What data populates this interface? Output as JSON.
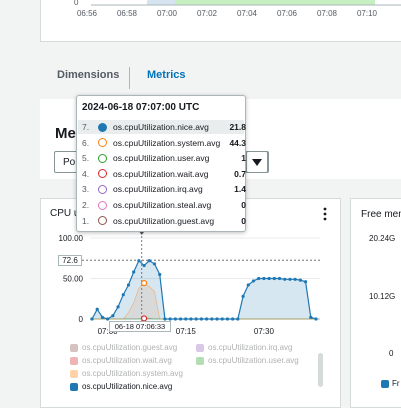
{
  "top_chart": {
    "x_ticks": [
      "06:56",
      "06:58",
      "07:00",
      "07:02",
      "07:04",
      "07:06",
      "07:08",
      "07:10"
    ],
    "y_zero": "0"
  },
  "tabs": [
    {
      "label": "Dimensions",
      "active": false
    },
    {
      "label": "Metrics",
      "active": true
    }
  ],
  "metrics_section": {
    "heading_partial": "Me",
    "dropdown_partial": "Po"
  },
  "cpu_widget": {
    "title_partial": "CPU u",
    "menu_icon": "kebab-menu-icon",
    "y_ticks": [
      "100.00",
      "50.00",
      "0"
    ],
    "x_ticks": [
      "07:00",
      "07:15",
      "07:30"
    ],
    "cursor_y_label": "72.6",
    "cursor_x_label": "06-18 07:06:33"
  },
  "tooltip": {
    "title": "2024-06-18 07:07:00 UTC",
    "rows": [
      {
        "num": "7.",
        "name": "os.cpuUtilization.nice.avg",
        "value": "21.8",
        "color": "#1f78b4",
        "filled": true
      },
      {
        "num": "6.",
        "name": "os.cpuUtilization.system.avg",
        "value": "44.3",
        "color": "#ff7f0e",
        "filled": false
      },
      {
        "num": "5.",
        "name": "os.cpuUtilization.user.avg",
        "value": "1",
        "color": "#2ca02c",
        "filled": false
      },
      {
        "num": "4.",
        "name": "os.cpuUtilization.wait.avg",
        "value": "0.7",
        "color": "#d62728",
        "filled": false
      },
      {
        "num": "3.",
        "name": "os.cpuUtilization.irq.avg",
        "value": "1.4",
        "color": "#9467bd",
        "filled": false
      },
      {
        "num": "2.",
        "name": "os.cpuUtilization.steal.avg",
        "value": "0",
        "color": "#e377c2",
        "filled": false
      },
      {
        "num": "1.",
        "name": "os.cpuUtilization.guest.avg",
        "value": "0",
        "color": "#8c564b",
        "filled": false
      }
    ]
  },
  "legend": {
    "items": [
      {
        "name": "os.cpuUtilization.guest.avg",
        "color": "#8c564b",
        "faded": true
      },
      {
        "name": "os.cpuUtilization.irq.avg",
        "color": "#9467bd",
        "faded": true
      },
      {
        "name": "os.cpuUtilization.wait.avg",
        "color": "#d62728",
        "faded": true
      },
      {
        "name": "os.cpuUtilization.user.avg",
        "color": "#2ca02c",
        "faded": true
      },
      {
        "name": "os.cpuUtilization.system.avg",
        "color": "#ff7f0e",
        "faded": true
      },
      {
        "name": "os.cpuUtilization.nice.avg",
        "color": "#1f78b4",
        "faded": false
      }
    ]
  },
  "free_mem_widget": {
    "title_partial": "Free mem",
    "y_ticks": [
      "20.24G",
      "10.12G",
      "0"
    ],
    "legend_partial": "Fr"
  },
  "chart_data": {
    "type": "area",
    "title": "",
    "xlabel": "",
    "ylabel": "",
    "ylim": [
      0,
      100
    ],
    "x_tick_labels": [
      "07:00",
      "07:15",
      "07:30"
    ],
    "x": [
      "06:57",
      "06:58",
      "06:59",
      "07:00",
      "07:01",
      "07:02",
      "07:03",
      "07:04",
      "07:05",
      "07:06",
      "07:07",
      "07:08",
      "07:09",
      "07:10",
      "07:11",
      "07:12",
      "07:13",
      "07:14",
      "07:15",
      "07:16",
      "07:17",
      "07:18",
      "07:19",
      "07:20",
      "07:21",
      "07:22",
      "07:23",
      "07:24",
      "07:25",
      "07:26",
      "07:27",
      "07:28",
      "07:29",
      "07:30",
      "07:31",
      "07:32",
      "07:33",
      "07:34",
      "07:35",
      "07:36",
      "07:37",
      "07:38",
      "07:39",
      "07:40"
    ],
    "series": [
      {
        "name": "os.cpuUtilization.nice.avg",
        "color": "#1f78b4",
        "values": [
          0,
          12,
          2,
          0,
          4,
          15,
          30,
          42,
          58,
          72,
          66,
          72,
          68,
          55,
          0,
          0,
          0,
          0,
          0,
          0,
          0,
          0,
          0,
          0,
          0,
          0,
          0,
          0,
          0,
          28,
          42,
          47,
          50,
          50,
          50,
          50,
          50,
          49,
          49,
          49,
          48,
          46,
          2,
          0
        ]
      },
      {
        "name": "os.cpuUtilization.system.avg",
        "color": "#ff7f0e",
        "values": [
          0,
          0,
          0,
          0,
          0,
          0,
          0,
          8,
          20,
          38,
          44,
          40,
          34,
          0,
          0,
          0,
          0,
          0,
          0,
          0,
          0,
          0,
          0,
          0,
          0,
          0,
          0,
          0,
          0,
          0,
          0,
          0,
          0,
          0,
          0,
          0,
          0,
          0,
          0,
          0,
          0,
          0,
          0,
          0
        ]
      },
      {
        "name": "os.cpuUtilization.user.avg",
        "color": "#2ca02c",
        "values": [
          0,
          0,
          0,
          0,
          0,
          0,
          0,
          0,
          0,
          0,
          1,
          1,
          0,
          0,
          0,
          0,
          0,
          0,
          0,
          0,
          0,
          0,
          0,
          0,
          0,
          0,
          0,
          0,
          0,
          0,
          0,
          0,
          0,
          0,
          0,
          0,
          0,
          0,
          0,
          0,
          0,
          0,
          0,
          0
        ]
      }
    ],
    "crosshair": {
      "x": "07:06:33",
      "y": 72.6
    },
    "grid": true
  }
}
